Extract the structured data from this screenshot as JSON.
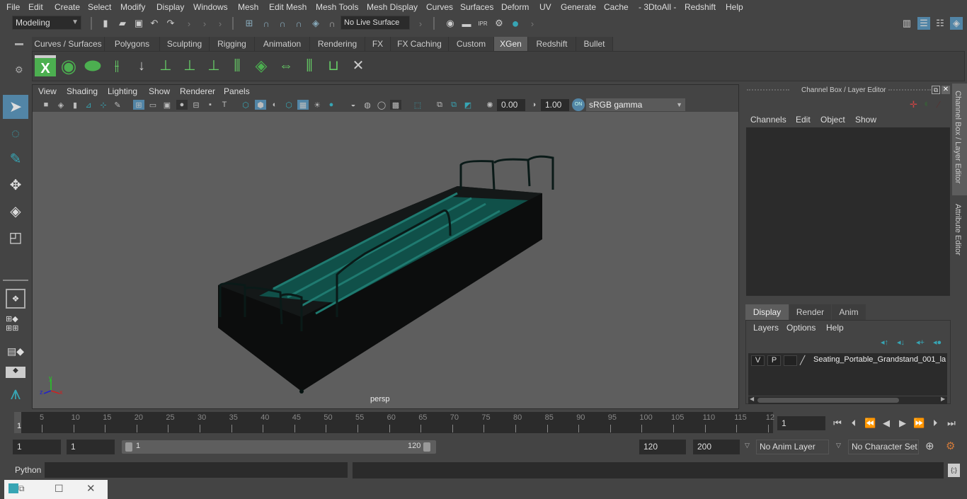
{
  "menubar": {
    "items": [
      "File",
      "Edit",
      "Create",
      "Select",
      "Modify",
      "Display",
      "Windows",
      "Mesh",
      "Edit Mesh",
      "Mesh Tools",
      "Mesh Display",
      "Curves",
      "Surfaces",
      "Deform",
      "UV",
      "Generate",
      "Cache",
      "- 3DtoAll -",
      "Redshift",
      "Help"
    ]
  },
  "statusline": {
    "mode_selector": "Modeling",
    "live_surface": "No Live Surface"
  },
  "shelf": {
    "tabs": [
      "Curves / Surfaces",
      "Polygons",
      "Sculpting",
      "Rigging",
      "Animation",
      "Rendering",
      "FX",
      "FX Caching",
      "Custom",
      "XGen",
      "Redshift",
      "Bullet"
    ],
    "active_tab": "XGen",
    "icons": [
      "xgen-editor-icon",
      "preview-visible-icon",
      "preview-hidden-icon",
      "add-guides-icon",
      "place-guides-icon",
      "add-modifier-icon",
      "show-guides-icon",
      "lock-guides-icon",
      "sculpt-guides-icon",
      "density-icon",
      "flip-guides-icon",
      "select-guides-icon",
      "toggle-guides-icon",
      "delete-guides-icon"
    ]
  },
  "panel": {
    "menus": [
      "View",
      "Shading",
      "Lighting",
      "Show",
      "Renderer",
      "Panels"
    ],
    "exposure": "0.00",
    "gamma": "1.00",
    "color_management": "ON",
    "color_space": "sRGB gamma",
    "camera_label": "persp",
    "axis": {
      "x": "x",
      "y": "y",
      "z": "z"
    }
  },
  "channel_box": {
    "title": "Channel Box / Layer Editor",
    "menus": [
      "Channels",
      "Edit",
      "Object",
      "Show"
    ],
    "layer_tabs": [
      "Display",
      "Render",
      "Anim"
    ],
    "active_layer_tab": "Display",
    "layer_menus": [
      "Layers",
      "Options",
      "Help"
    ],
    "layers": [
      {
        "v": "V",
        "p": "P",
        "name": "Seating_Portable_Grandstand_001_la"
      }
    ]
  },
  "side_tabs": [
    "Channel Box / Layer Editor",
    "Attribute Editor"
  ],
  "timeline": {
    "start_marker": "1",
    "ticks": [
      "5",
      "10",
      "15",
      "20",
      "25",
      "30",
      "35",
      "40",
      "45",
      "50",
      "55",
      "60",
      "65",
      "70",
      "75",
      "80",
      "85",
      "90",
      "95",
      "100",
      "105",
      "110",
      "115",
      "12"
    ],
    "current_frame": "1"
  },
  "range": {
    "start": "1",
    "playback_start": "1",
    "slider_start": "1",
    "slider_end": "120",
    "playback_end": "120",
    "end": "200",
    "anim_layer": "No Anim Layer",
    "character_set": "No Character Set"
  },
  "command_line": {
    "language": "Python",
    "input": "",
    "output": ""
  },
  "colors": {
    "accent": "#5285a6",
    "teal": "#37a5b4",
    "model_teal": "#0f5a52",
    "key_orange": "#d17a3a"
  }
}
